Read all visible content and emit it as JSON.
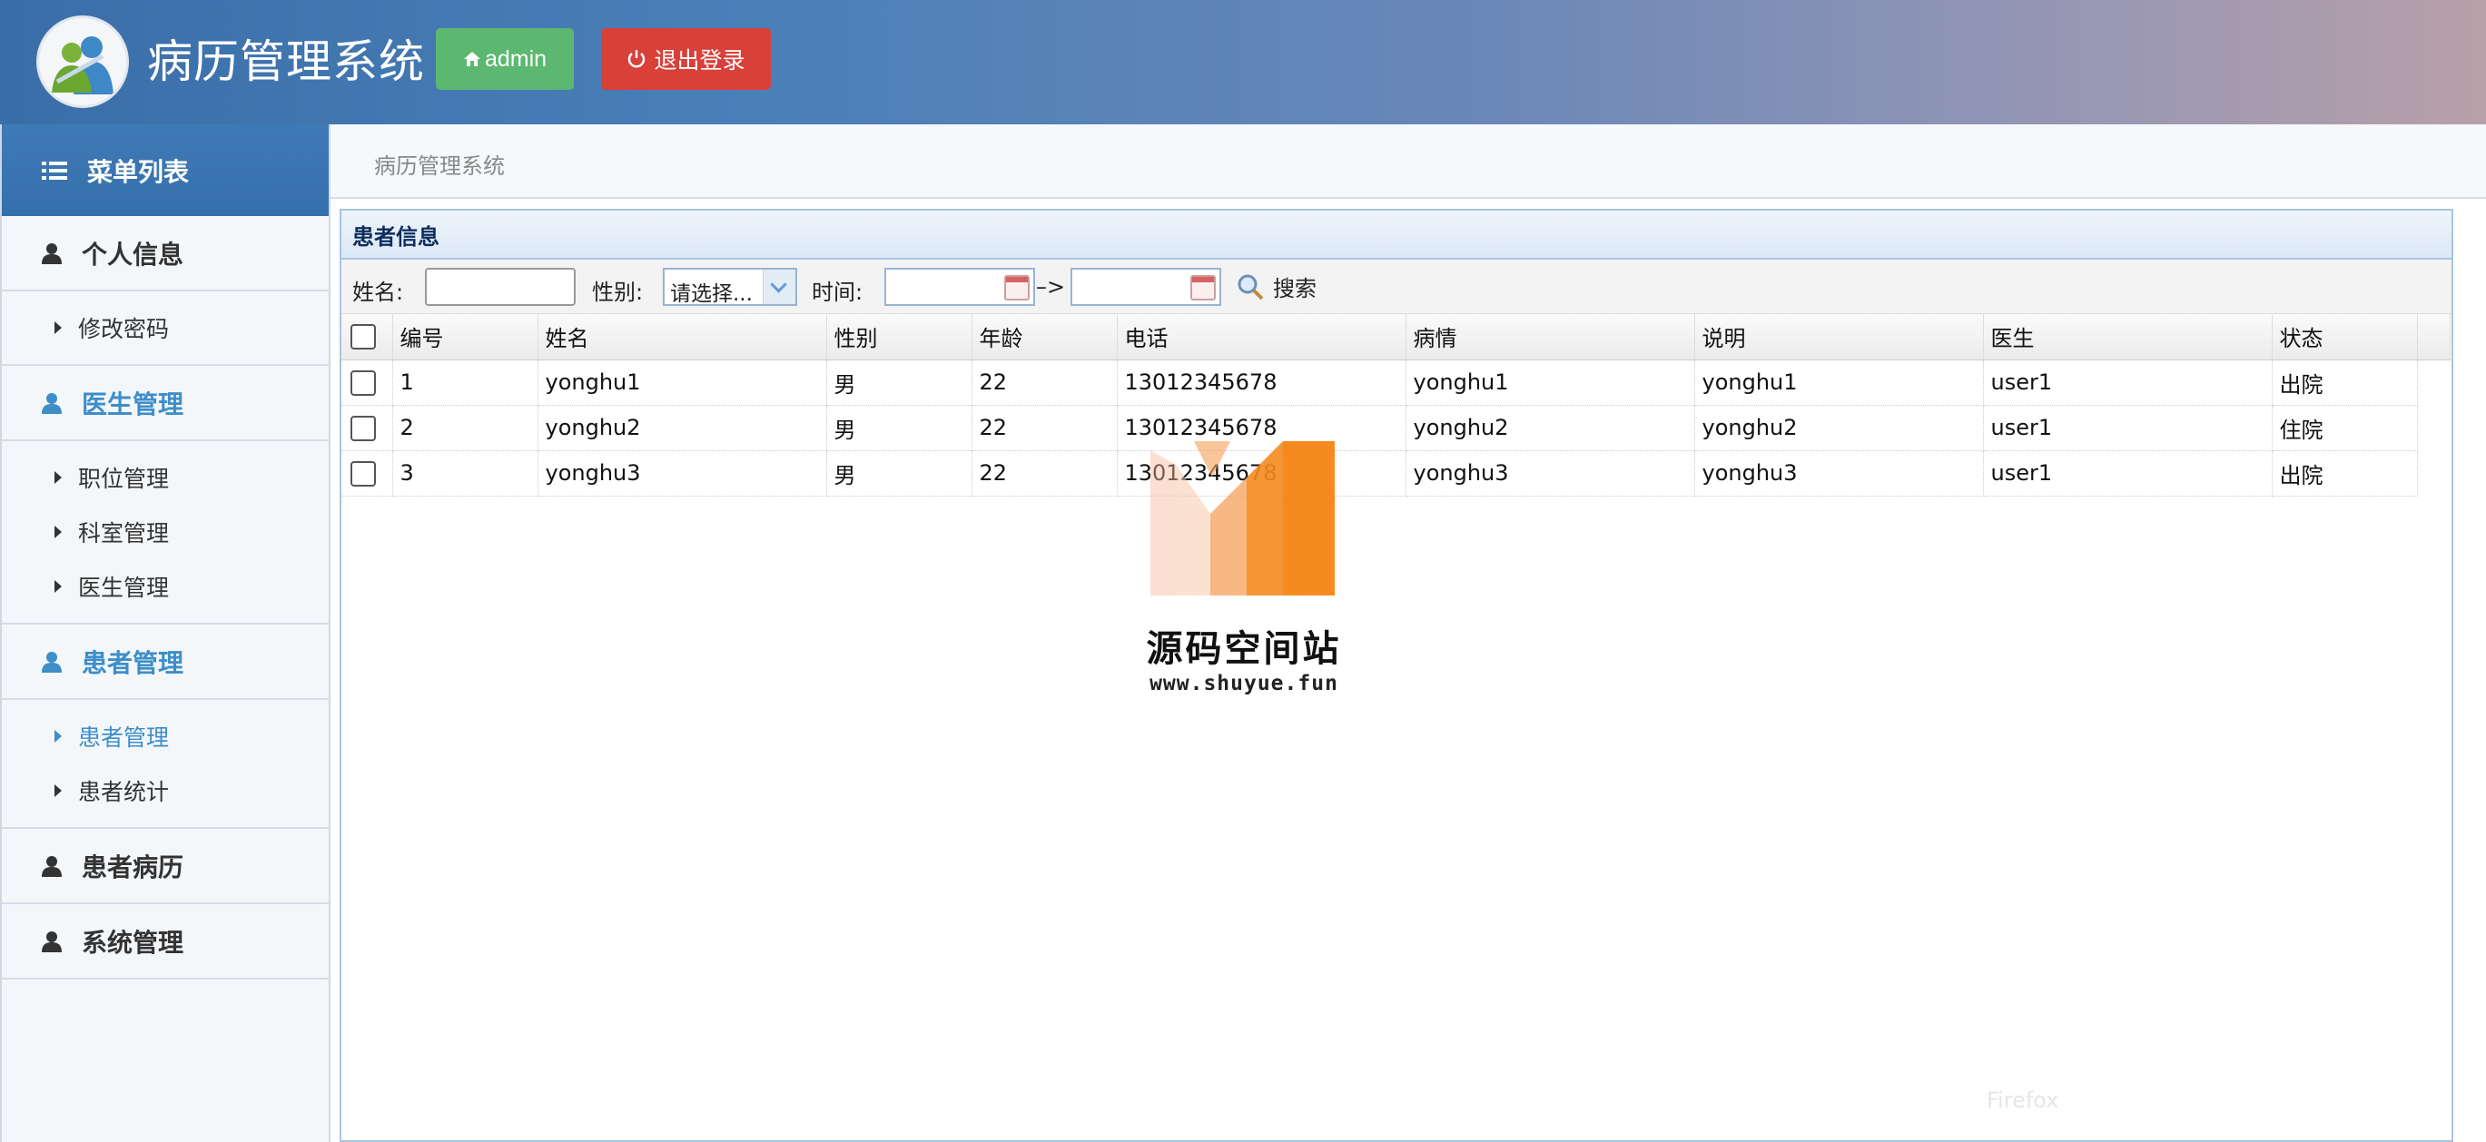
{
  "header": {
    "title": "病历管理系统",
    "admin_label": "admin",
    "logout_label": "退出登录"
  },
  "sidebar": {
    "menu_title": "菜单列表",
    "sections": [
      {
        "label": "个人信息",
        "items": [
          "修改密码"
        ]
      },
      {
        "label": "医生管理",
        "items": [
          "职位管理",
          "科室管理",
          "医生管理"
        ]
      },
      {
        "label": "患者管理",
        "items": [
          "患者管理",
          "患者统计"
        ],
        "active_item": "患者管理"
      },
      {
        "label": "患者病历",
        "items": []
      },
      {
        "label": "系统管理",
        "items": []
      }
    ]
  },
  "breadcrumb": "病历管理系统",
  "panel": {
    "title": "患者信息",
    "filters": {
      "name_label": "姓名:",
      "name_value": "",
      "gender_label": "性别:",
      "gender_selected": "请选择...",
      "time_label": "时间:",
      "time_from": "",
      "range_sep": "–>",
      "time_to": "",
      "search_label": "搜索"
    },
    "table": {
      "columns": [
        "编号",
        "姓名",
        "性别",
        "年龄",
        "电话",
        "病情",
        "说明",
        "医生",
        "状态"
      ],
      "rows": [
        [
          "1",
          "yonghu1",
          "男",
          "22",
          "13012345678",
          "yonghu1",
          "yonghu1",
          "user1",
          "出院"
        ],
        [
          "2",
          "yonghu2",
          "男",
          "22",
          "13012345678",
          "yonghu2",
          "yonghu2",
          "user1",
          "住院"
        ],
        [
          "3",
          "yonghu3",
          "男",
          "22",
          "13012345678",
          "yonghu3",
          "yonghu3",
          "user1",
          "出院"
        ]
      ]
    }
  },
  "watermark": {
    "name": "源码空间站",
    "url": "www.shuyue.fun"
  },
  "ghost_text": "Firefox",
  "colors": {
    "header_start": "#3a6ea8",
    "admin_button": "#5cb870",
    "logout_button": "#d9403a",
    "accent_blue": "#3d8ec9",
    "watermark_orange": "#f58a1f"
  }
}
